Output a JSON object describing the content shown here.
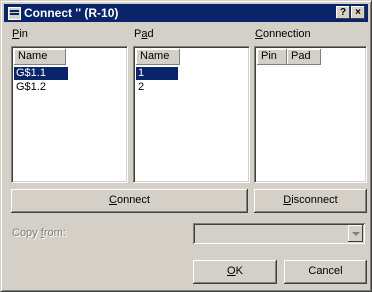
{
  "window": {
    "title": "Connect '' (R-10)",
    "help_button": "?",
    "close_button": "×"
  },
  "pin": {
    "label_mnemonic": "P",
    "label_rest": "in",
    "column": "Name",
    "items": [
      "G$1.1",
      "G$1.2"
    ],
    "selected_index": 0
  },
  "pad": {
    "label_first": "P",
    "label_mnemonic": "a",
    "label_rest": "d",
    "column": "Name",
    "items": [
      "1",
      "2"
    ],
    "selected_index": 0
  },
  "connection": {
    "label_mnemonic": "C",
    "label_rest": "onnection",
    "columns": [
      "Pin",
      "Pad"
    ]
  },
  "buttons": {
    "connect_mnemonic": "C",
    "connect_rest": "onnect",
    "disconnect_mnemonic": "D",
    "disconnect_rest": "isconnect",
    "ok_mnemonic": "O",
    "ok_rest": "K",
    "cancel": "Cancel"
  },
  "copy_from": {
    "label_first": "Copy ",
    "label_mnemonic": "f",
    "label_rest": "rom:",
    "value": "",
    "enabled": false
  }
}
